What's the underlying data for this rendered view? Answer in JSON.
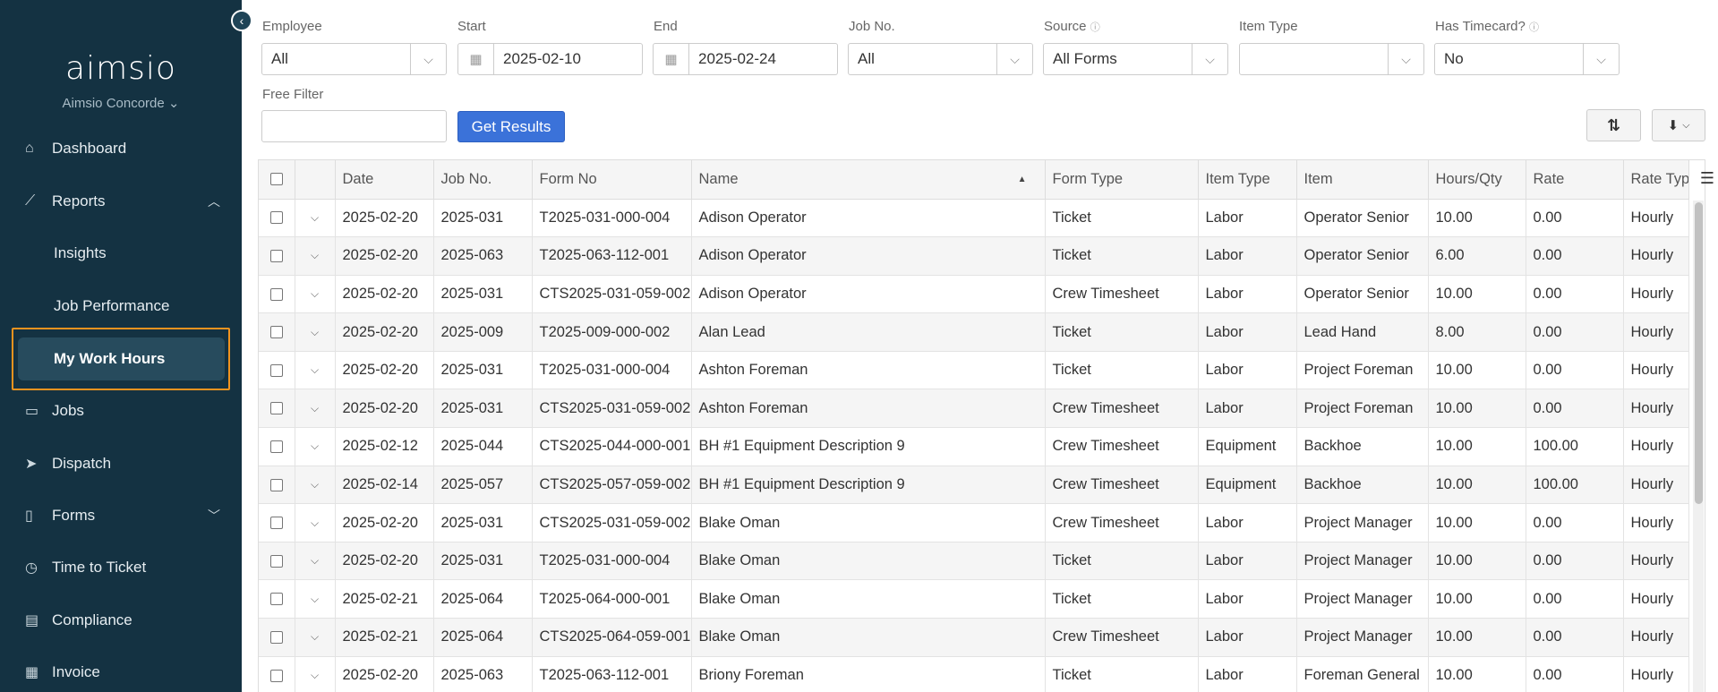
{
  "app": {
    "logo_text": "aimsio",
    "org_name": "Aimsio Concorde ⌄"
  },
  "sidebar": {
    "items": [
      {
        "label": "Dashboard",
        "icon": "home-icon"
      },
      {
        "label": "Reports",
        "icon": "chart-icon",
        "expanded": true
      },
      {
        "label": "Insights",
        "sub": true
      },
      {
        "label": "Job Performance",
        "sub": true
      },
      {
        "label": "My Work Hours",
        "sub": true,
        "active": true
      },
      {
        "label": "Jobs",
        "icon": "folder-icon"
      },
      {
        "label": "Dispatch",
        "icon": "send-icon"
      },
      {
        "label": "Forms",
        "icon": "clipboard-icon",
        "expanded": false
      },
      {
        "label": "Time to Ticket",
        "icon": "clock-icon"
      },
      {
        "label": "Compliance",
        "icon": "compliance-icon"
      },
      {
        "label": "Invoice",
        "icon": "invoice-icon"
      }
    ]
  },
  "filters": {
    "employee": {
      "label": "Employee",
      "value": "All"
    },
    "start": {
      "label": "Start",
      "value": "2025-02-10"
    },
    "end": {
      "label": "End",
      "value": "2025-02-24"
    },
    "job_no": {
      "label": "Job No.",
      "value": "All"
    },
    "source": {
      "label": "Source",
      "value": "All Forms"
    },
    "item_type": {
      "label": "Item Type",
      "value": ""
    },
    "has_timecard": {
      "label": "Has Timecard?",
      "value": "No"
    },
    "free_filter": {
      "label": "Free Filter",
      "value": ""
    },
    "get_results_label": "Get Results"
  },
  "table": {
    "columns": [
      "Date",
      "Job No.",
      "Form No",
      "Name",
      "Form Type",
      "Item Type",
      "Item",
      "Hours/Qty",
      "Rate",
      "Rate Type"
    ],
    "sorted_column": "Name",
    "rows": [
      [
        "2025-02-20",
        "2025-031",
        "T2025-031-000-004",
        "Adison Operator",
        "Ticket",
        "Labor",
        "Operator Senior",
        "10.00",
        "0.00",
        "Hourly"
      ],
      [
        "2025-02-20",
        "2025-063",
        "T2025-063-112-001",
        "Adison Operator",
        "Ticket",
        "Labor",
        "Operator Senior",
        "6.00",
        "0.00",
        "Hourly"
      ],
      [
        "2025-02-20",
        "2025-031",
        "CTS2025-031-059-002",
        "Adison Operator",
        "Crew Timesheet",
        "Labor",
        "Operator Senior",
        "10.00",
        "0.00",
        "Hourly"
      ],
      [
        "2025-02-20",
        "2025-009",
        "T2025-009-000-002",
        "Alan Lead",
        "Ticket",
        "Labor",
        "Lead Hand",
        "8.00",
        "0.00",
        "Hourly"
      ],
      [
        "2025-02-20",
        "2025-031",
        "T2025-031-000-004",
        "Ashton Foreman",
        "Ticket",
        "Labor",
        "Project Foreman",
        "10.00",
        "0.00",
        "Hourly"
      ],
      [
        "2025-02-20",
        "2025-031",
        "CTS2025-031-059-002",
        "Ashton Foreman",
        "Crew Timesheet",
        "Labor",
        "Project Foreman",
        "10.00",
        "0.00",
        "Hourly"
      ],
      [
        "2025-02-12",
        "2025-044",
        "CTS2025-044-000-001",
        "BH #1 Equipment Description 9",
        "Crew Timesheet",
        "Equipment",
        "Backhoe",
        "10.00",
        "100.00",
        "Hourly"
      ],
      [
        "2025-02-14",
        "2025-057",
        "CTS2025-057-059-002",
        "BH #1 Equipment Description 9",
        "Crew Timesheet",
        "Equipment",
        "Backhoe",
        "10.00",
        "100.00",
        "Hourly"
      ],
      [
        "2025-02-20",
        "2025-031",
        "CTS2025-031-059-002",
        "Blake Oman",
        "Crew Timesheet",
        "Labor",
        "Project Manager",
        "10.00",
        "0.00",
        "Hourly"
      ],
      [
        "2025-02-20",
        "2025-031",
        "T2025-031-000-004",
        "Blake Oman",
        "Ticket",
        "Labor",
        "Project Manager",
        "10.00",
        "0.00",
        "Hourly"
      ],
      [
        "2025-02-21",
        "2025-064",
        "T2025-064-000-001",
        "Blake Oman",
        "Ticket",
        "Labor",
        "Project Manager",
        "10.00",
        "0.00",
        "Hourly"
      ],
      [
        "2025-02-21",
        "2025-064",
        "CTS2025-064-059-001",
        "Blake Oman",
        "Crew Timesheet",
        "Labor",
        "Project Manager",
        "10.00",
        "0.00",
        "Hourly"
      ],
      [
        "2025-02-20",
        "2025-063",
        "T2025-063-112-001",
        "Briony Foreman",
        "Ticket",
        "Labor",
        "Foreman General",
        "10.00",
        "0.00",
        "Hourly"
      ]
    ]
  }
}
